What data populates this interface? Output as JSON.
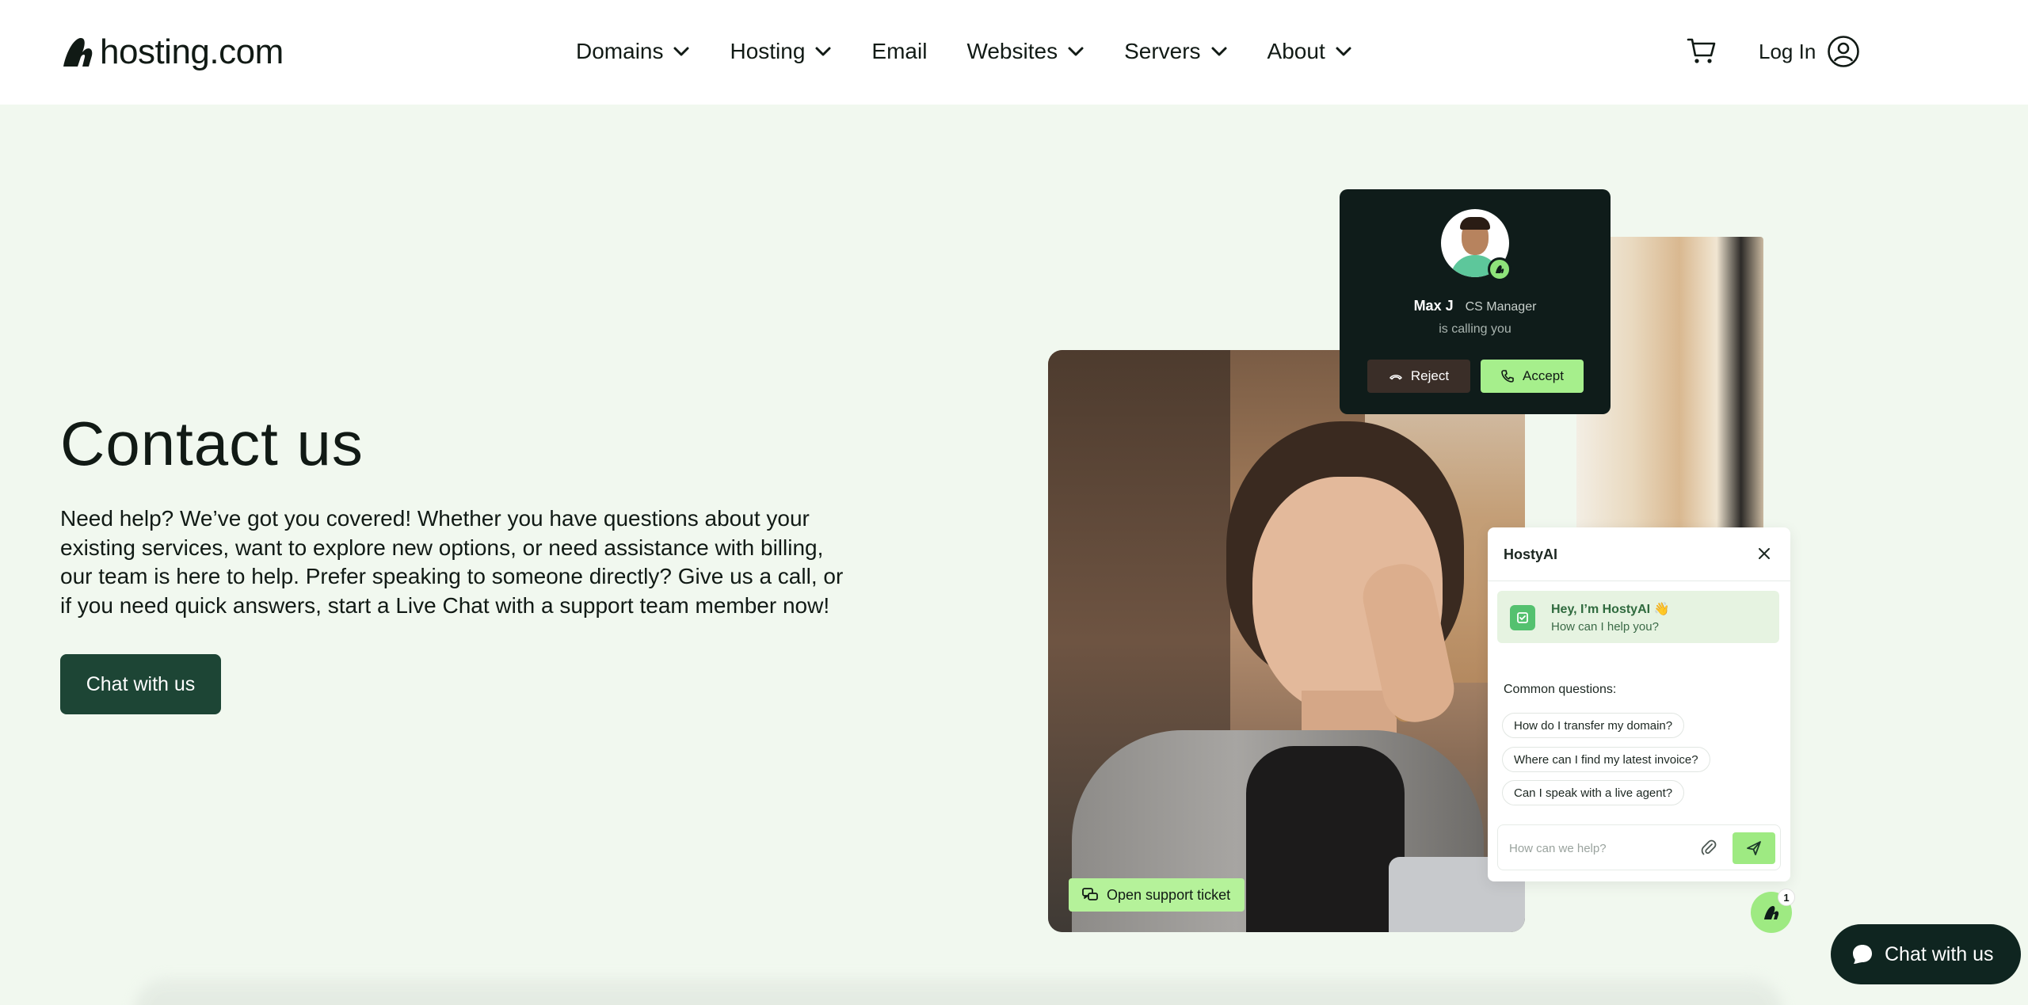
{
  "brand": {
    "name": "hosting.com"
  },
  "nav": {
    "items": [
      {
        "label": "Domains",
        "dropdown": true
      },
      {
        "label": "Hosting",
        "dropdown": true
      },
      {
        "label": "Email",
        "dropdown": false
      },
      {
        "label": "Websites",
        "dropdown": true
      },
      {
        "label": "Servers",
        "dropdown": true
      },
      {
        "label": "About",
        "dropdown": true
      }
    ],
    "login_label": "Log In"
  },
  "hero": {
    "title": "Contact us",
    "text": "Need help? We’ve got you covered! Whether you have questions about your existing services, want to explore new options, or need assistance with billing, our team is here to help. Prefer speaking to someone directly? Give us a call, or if you need quick answers, start a Live Chat with a support team member now!",
    "cta_label": "Chat with us"
  },
  "call_card": {
    "caller_name": "Max J",
    "caller_role": "CS Manager",
    "status_text": "is calling you",
    "reject_label": "Reject",
    "accept_label": "Accept"
  },
  "ticket_badge": {
    "label": "Open support ticket"
  },
  "chat_widget": {
    "title": "HostyAI",
    "greeting_title": "Hey, I’m HostyAI 👋",
    "greeting_sub": "How can I help you?",
    "common_label": "Common questions:",
    "questions": [
      "How do I transfer my domain?",
      "Where can I find my latest invoice?",
      "Can I speak with a live agent?"
    ],
    "input_placeholder": "How can we help?",
    "launcher_badge": "1"
  },
  "floating_chat": {
    "label": "Chat with us"
  },
  "colors": {
    "page_background": "#f1f8ef",
    "header_background": "#ffffff",
    "primary_dark": "#1d4535",
    "accent_green": "#a6ef8c",
    "text": "#111a15"
  },
  "icons": {
    "nav_dropdown": "chevron-down-icon",
    "cart": "cart-icon",
    "account": "user-circle-icon",
    "reject": "hang-up-icon",
    "accept": "phone-icon",
    "ticket": "chat-bubbles-icon",
    "close": "close-icon",
    "attach": "paperclip-icon",
    "send": "send-icon",
    "chat": "chat-bubble-icon"
  }
}
